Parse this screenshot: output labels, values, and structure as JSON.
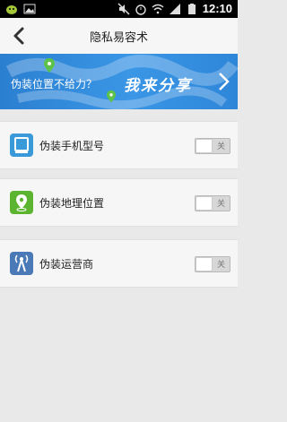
{
  "status_bar": {
    "time": "12:10"
  },
  "header": {
    "title": "隐私易容术"
  },
  "banner": {
    "text_left": "伪装位置不给力？",
    "text_right": "我来分享"
  },
  "settings": [
    {
      "label": "伪装手机型号",
      "state": "关",
      "icon": "phone-model-icon",
      "color": "#3a9ad9"
    },
    {
      "label": "伪装地理位置",
      "state": "关",
      "icon": "location-pin-icon",
      "color": "#5cb531"
    },
    {
      "label": "伪装运营商",
      "state": "关",
      "icon": "signal-tower-icon",
      "color": "#4b78b6"
    }
  ]
}
